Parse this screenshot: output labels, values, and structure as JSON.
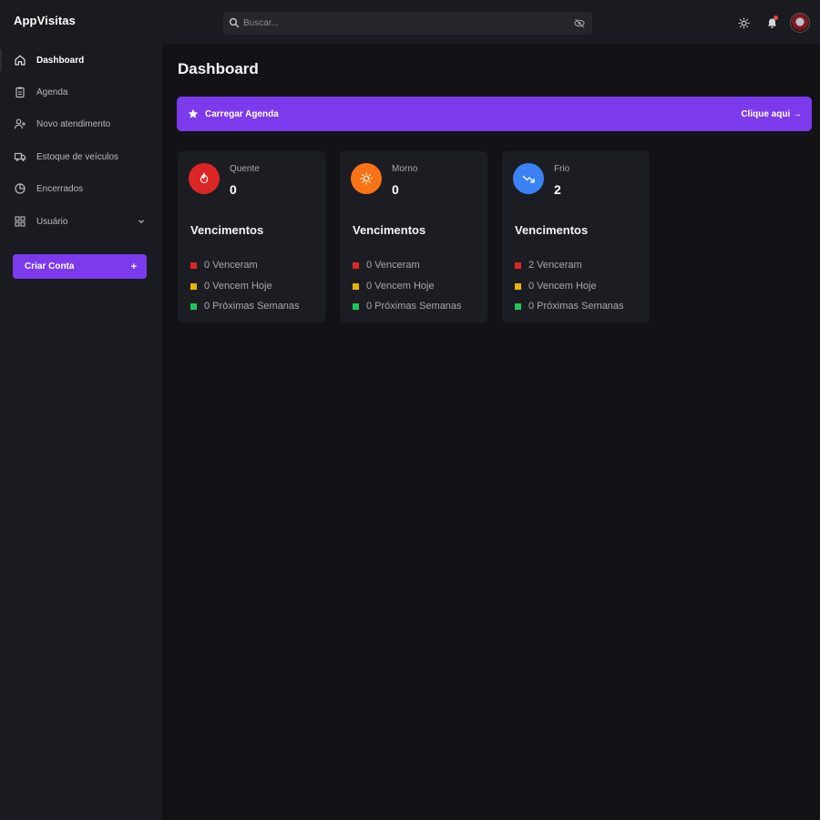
{
  "brand": "AppVisitas",
  "search": {
    "placeholder": "Buscar..."
  },
  "sidebar": {
    "items": [
      {
        "label": "Dashboard",
        "icon": "home-icon",
        "active": true
      },
      {
        "label": "Agenda",
        "icon": "clipboard-icon"
      },
      {
        "label": "Novo atendimento",
        "icon": "user-plus-icon"
      },
      {
        "label": "Estoque de veículos",
        "icon": "truck-icon"
      },
      {
        "label": "Encerrados",
        "icon": "pie-chart-icon"
      },
      {
        "label": "Usuário",
        "icon": "user-grid-icon",
        "has_submenu": true
      }
    ],
    "cta": {
      "label": "Criar Conta",
      "plus": "+"
    }
  },
  "page": {
    "title": "Dashboard"
  },
  "banner": {
    "label": "Carregar Agenda",
    "link": "Clique aqui →"
  },
  "cards": [
    {
      "label": "Quente",
      "count": "0",
      "icon": "fire-icon",
      "color": "#dc2626",
      "title": "Vencimentos",
      "rows": [
        "0 Venceram",
        "0 Vencem Hoje",
        "0 Próximas Semanas"
      ]
    },
    {
      "label": "Morno",
      "count": "0",
      "icon": "sun-icon",
      "color": "#f97316",
      "title": "Vencimentos",
      "rows": [
        "0 Venceram",
        "0 Vencem Hoje",
        "0 Próximas Semanas"
      ]
    },
    {
      "label": "Frio",
      "count": "2",
      "icon": "trend-down-icon",
      "color": "#3b82f6",
      "title": "Vencimentos",
      "rows": [
        "2 Venceram",
        "0 Vencem Hoje",
        "0 Próximas Semanas"
      ]
    }
  ],
  "status_colors": {
    "overdue": "#dc2626",
    "today": "#eab308",
    "upcoming": "#22c55e"
  },
  "accent": "#7c3aed"
}
